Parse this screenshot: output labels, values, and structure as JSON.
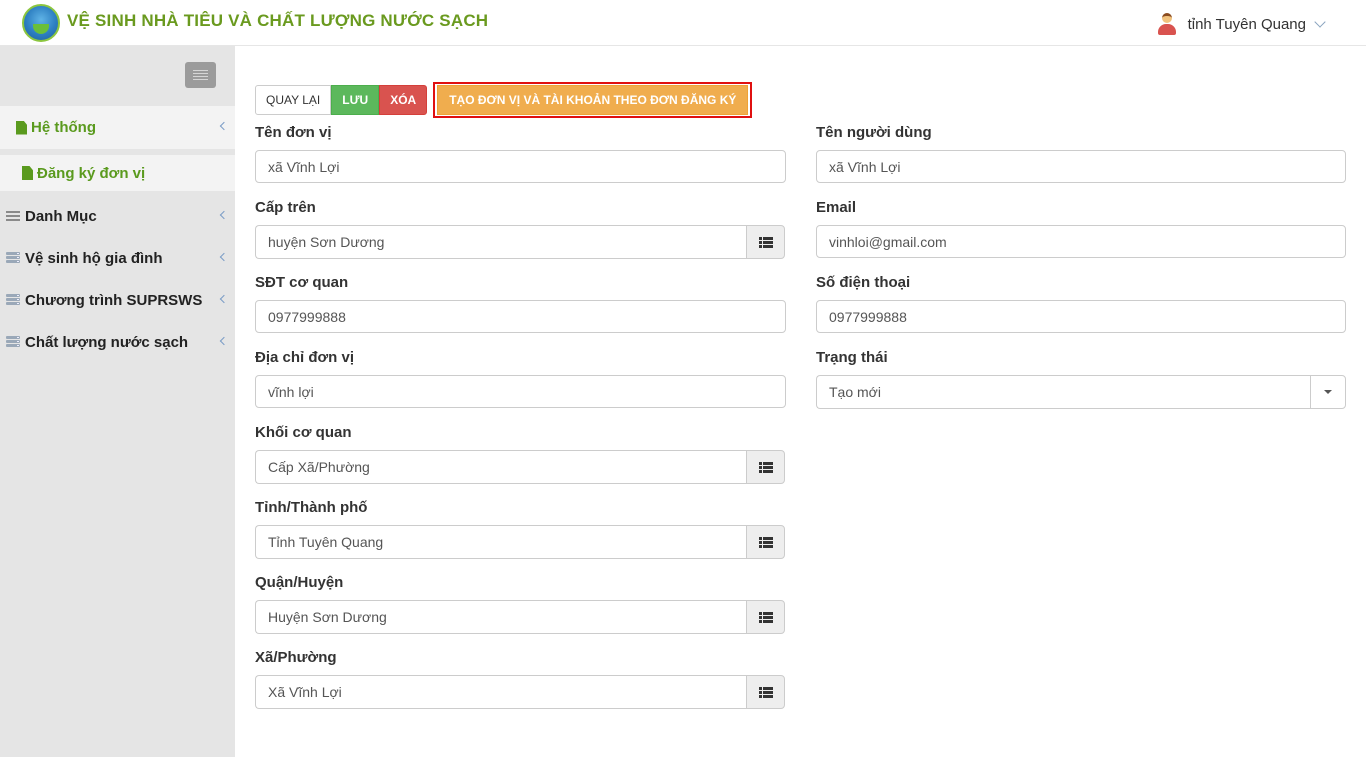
{
  "header": {
    "title": "VỆ SINH NHÀ TIÊU VÀ CHẤT LƯỢNG NƯỚC SẠCH",
    "user_name": "tỉnh Tuyên Quang"
  },
  "sidebar": {
    "items": [
      {
        "label": "Hệ thống",
        "icon": "file-icon"
      },
      {
        "label": "Đăng ký đơn vị",
        "icon": "file-icon"
      },
      {
        "label": "Danh Mục",
        "icon": "list-icon"
      },
      {
        "label": "Vệ sinh hộ gia đình",
        "icon": "server-icon"
      },
      {
        "label": "Chương trình SUPRSWS",
        "icon": "server-icon"
      },
      {
        "label": "Chất lượng nước sạch",
        "icon": "server-icon"
      }
    ]
  },
  "toolbar": {
    "back_label": "QUAY LẠI",
    "save_label": "LƯU",
    "delete_label": "XÓA",
    "create_label": "TẠO ĐƠN VỊ VÀ TÀI KHOẢN THEO ĐƠN ĐĂNG KÝ"
  },
  "form": {
    "left": [
      {
        "label": "Tên đơn vị",
        "value": "xã Vĩnh Lợi"
      },
      {
        "label": "Cấp trên",
        "value": "huyện Sơn Dương"
      },
      {
        "label": "SĐT cơ quan",
        "value": "0977999888"
      },
      {
        "label": "Địa chỉ đơn vị",
        "value": "vĩnh lợi"
      },
      {
        "label": "Khối cơ quan",
        "value": "Cấp Xã/Phường"
      },
      {
        "label": "Tỉnh/Thành phố",
        "value": "Tỉnh Tuyên Quang"
      },
      {
        "label": "Quận/Huyện",
        "value": "Huyện Sơn Dương"
      },
      {
        "label": "Xã/Phường",
        "value": "Xã Vĩnh Lợi"
      }
    ],
    "right": [
      {
        "label": "Tên người dùng",
        "value": "xã Vĩnh Lợi"
      },
      {
        "label": "Email",
        "value": "vinhloi@gmail.com"
      },
      {
        "label": "Số điện thoại",
        "value": "0977999888"
      },
      {
        "label": "Trạng thái",
        "value": "Tạo mới"
      }
    ]
  },
  "colors": {
    "brand_green": "#6a9a1e",
    "save": "#5cb85c",
    "delete": "#d9534f",
    "create": "#f0ad4e",
    "highlight_border": "#e01010"
  }
}
